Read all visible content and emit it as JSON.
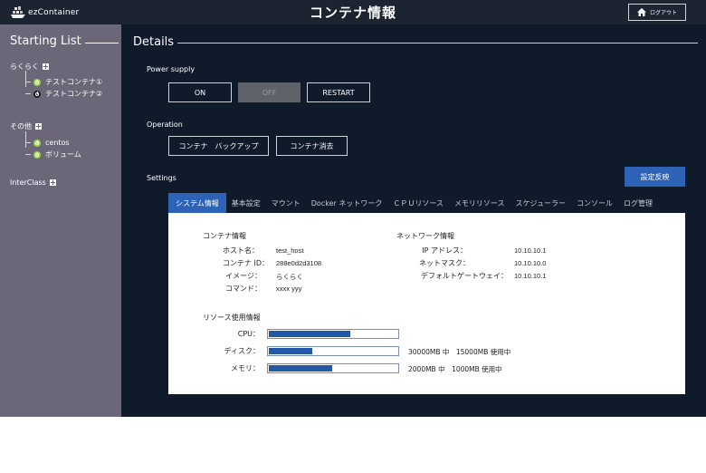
{
  "header": {
    "logo_text": "ezContainer",
    "title": "コンテナ情報",
    "logout_label": "ログアウト"
  },
  "sidebar": {
    "title": "Starting List",
    "groups": [
      {
        "label": "らくらく",
        "items": [
          {
            "label": "テストコンテナ①",
            "status": "on"
          },
          {
            "label": "テストコンテナ②",
            "status": "off"
          }
        ]
      },
      {
        "label": "その他",
        "items": [
          {
            "label": "centos",
            "status": "on"
          },
          {
            "label": "ボリューム",
            "status": "on"
          }
        ]
      },
      {
        "label": "InterClass",
        "items": []
      }
    ]
  },
  "main": {
    "title": "Details",
    "power": {
      "label": "Power supply",
      "on": "ON",
      "off": "OFF",
      "restart": "RESTART"
    },
    "operation": {
      "label": "Operation",
      "backup": "コンテナ　バックアップ",
      "delete": "コンテナ消去"
    },
    "settings": {
      "label": "Settings",
      "apply": "設定反映",
      "tabs": [
        "システム情報",
        "基本設定",
        "マウント",
        "Docker ネットワーク",
        "ＣＰＵリソース",
        "メモリリソース",
        "スケジューラー",
        "コンソール",
        "ログ管理"
      ]
    },
    "panel": {
      "container_info": {
        "heading": "コンテナ情報",
        "rows": [
          {
            "label": "ホスト名：",
            "value": "test_host"
          },
          {
            "label": "コンテナ ID：",
            "value": "288e0d2d3108"
          },
          {
            "label": "イメージ：",
            "value": "らくらく"
          },
          {
            "label": "コマンド：",
            "value": "xxxx yyy"
          }
        ]
      },
      "network_info": {
        "heading": "ネットワーク情報",
        "rows": [
          {
            "label": "IP アドレス：",
            "value": "10.10.10.1"
          },
          {
            "label": "ネットマスク：",
            "value": "10.10.10.0"
          },
          {
            "label": "デフォルトゲートウェイ：",
            "value": "10.10.10.1"
          }
        ]
      },
      "resources": {
        "heading": "リソース使用情報",
        "rows": [
          {
            "label": "CPU：",
            "fill_fraction": 0.64,
            "text": ""
          },
          {
            "label": "ディスク：",
            "fill_fraction": 0.35,
            "text": "30000MB 中　15000MB 使用中"
          },
          {
            "label": "メモリ：",
            "fill_fraction": 0.5,
            "text": "2000MB 中　1000MB 使用中"
          }
        ]
      }
    }
  },
  "colors": {
    "header_bg": "#1b2430",
    "sidebar_bg": "#6c6679",
    "main_bg": "#0f1a2a",
    "accent": "#2c63b6",
    "status_on": "#9bd44a",
    "status_off": "#1c1c1c"
  }
}
